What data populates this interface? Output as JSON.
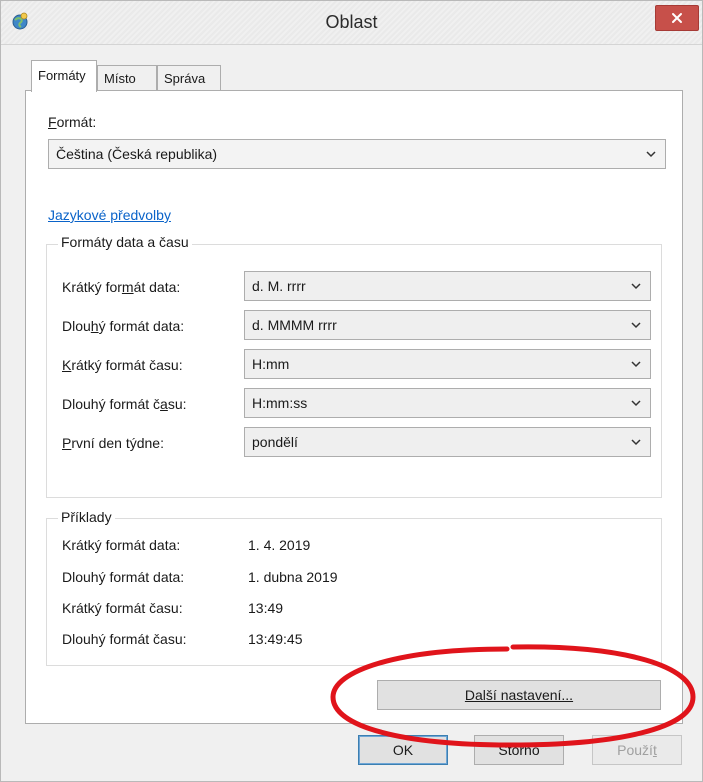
{
  "window": {
    "title": "Oblast",
    "close_icon": "close-icon",
    "app_icon": "region-globe-icon"
  },
  "tabs": [
    {
      "label": "Formáty",
      "active": true
    },
    {
      "label": "Místo",
      "active": false
    },
    {
      "label": "Správa",
      "active": false
    }
  ],
  "format": {
    "label": "Formát:",
    "label_accel": "F",
    "label_rest": "ormát:",
    "value": "Čeština (Česká republika)"
  },
  "language_link": "Jazykové předvolby",
  "datetime_group": {
    "title": "Formáty data a času",
    "rows": [
      {
        "label_pre": "Krátký for",
        "label_accel": "m",
        "label_post": "át data:",
        "value": "d. M. rrrr"
      },
      {
        "label_pre": "Dlou",
        "label_accel": "h",
        "label_post": "ý formát data:",
        "value": "d. MMMM rrrr"
      },
      {
        "label_pre": "",
        "label_accel": "K",
        "label_post": "rátký formát času:",
        "value": "H:mm"
      },
      {
        "label_pre": "Dlouhý formát č",
        "label_accel": "a",
        "label_post": "su:",
        "value": "H:mm:ss"
      },
      {
        "label_pre": "",
        "label_accel": "P",
        "label_post": "rvní den týdne:",
        "value": "pondělí"
      }
    ]
  },
  "examples_group": {
    "title": "Příklady",
    "rows": [
      {
        "label": "Krátký formát data:",
        "value": "1. 4. 2019"
      },
      {
        "label": "Dlouhý formát data:",
        "value": "1. dubna 2019"
      },
      {
        "label": "Krátký formát času:",
        "value": "13:49"
      },
      {
        "label": "Dlouhý formát času:",
        "value": "13:49:45"
      }
    ]
  },
  "buttons": {
    "more_settings": "Další nastavení...",
    "ok": "OK",
    "cancel": "Storno",
    "apply_pre": "Použí",
    "apply_accel": "t"
  },
  "colors": {
    "link": "#0a63c9",
    "close_button": "#c7504a",
    "annotation": "#e0141b"
  }
}
